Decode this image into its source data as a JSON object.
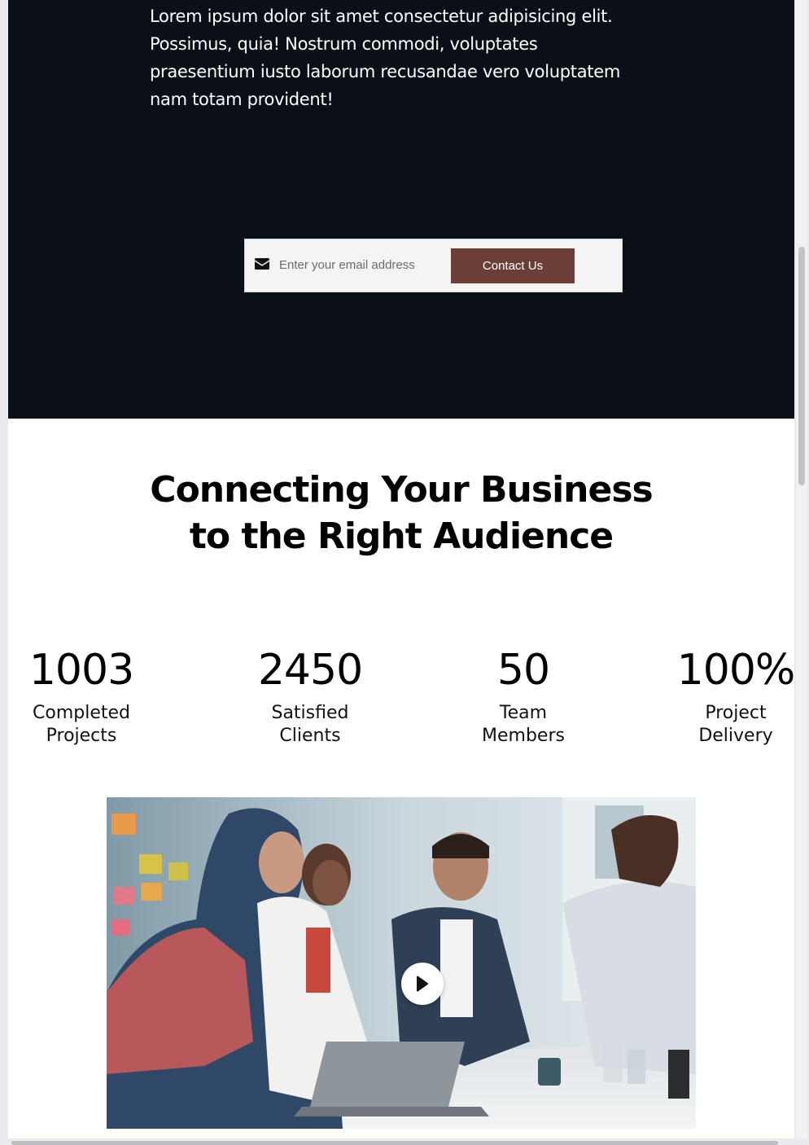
{
  "hero": {
    "paragraph": "Lorem ipsum dolor sit amet consectetur adipisicing elit. Possimus, quia! Nostrum commodi, voluptates praesentium iusto laborum recusandae vero voluptatem nam totam provident!",
    "email_icon": "envelope-icon",
    "email_placeholder": "Enter your email address",
    "contact_button": "Contact Us",
    "background_color": "#0b0f17",
    "button_color": "#6b3f38"
  },
  "headline": {
    "line1": "Connecting Your Business",
    "line2": "to the Right Audience"
  },
  "stats": [
    {
      "number": "1003",
      "label_line1": "Completed",
      "label_line2": "Projects"
    },
    {
      "number": "2450",
      "label_line1": "Satisfied",
      "label_line2": "Clients"
    },
    {
      "number": "50",
      "label_line1": "Team",
      "label_line2": "Members"
    },
    {
      "number": "100%",
      "label_line1": "Project",
      "label_line2": "Delivery"
    }
  ],
  "video": {
    "play_icon": "play-icon"
  }
}
